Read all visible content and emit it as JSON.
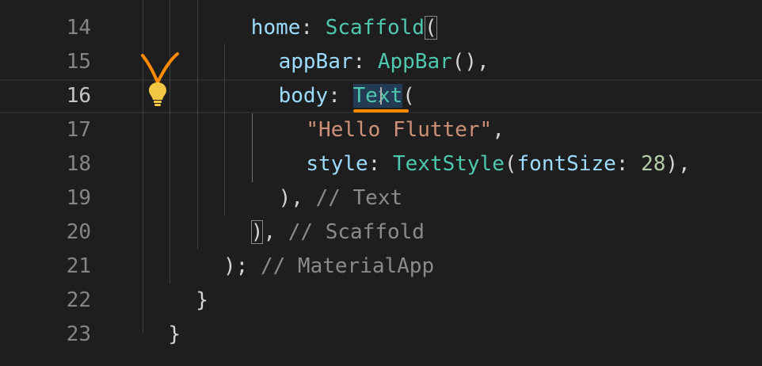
{
  "editor": {
    "lines": [
      {
        "number": "14",
        "tokens": [
          {
            "text": "home",
            "kind": "prop"
          },
          {
            "text": ": ",
            "kind": "punc"
          },
          {
            "text": "Scaffold",
            "kind": "cls"
          },
          {
            "text": "(",
            "kind": "punc",
            "bracket_match": true
          }
        ]
      },
      {
        "number": "15",
        "tokens": [
          {
            "text": "appBar",
            "kind": "prop"
          },
          {
            "text": ": ",
            "kind": "punc"
          },
          {
            "text": "AppBar",
            "kind": "cls"
          },
          {
            "text": "(),",
            "kind": "punc"
          }
        ]
      },
      {
        "number": "16",
        "tokens": [
          {
            "text": "body",
            "kind": "prop"
          },
          {
            "text": ": ",
            "kind": "punc"
          },
          {
            "text": "Text",
            "kind": "cls",
            "highlighted": true
          },
          {
            "text": "(",
            "kind": "punc"
          }
        ]
      },
      {
        "number": "17",
        "tokens": [
          {
            "text": "\"Hello Flutter\"",
            "kind": "str"
          },
          {
            "text": ",",
            "kind": "punc"
          }
        ]
      },
      {
        "number": "18",
        "tokens": [
          {
            "text": "style",
            "kind": "prop"
          },
          {
            "text": ": ",
            "kind": "punc"
          },
          {
            "text": "TextStyle",
            "kind": "cls"
          },
          {
            "text": "(",
            "kind": "punc"
          },
          {
            "text": "fontSize",
            "kind": "prop"
          },
          {
            "text": ": ",
            "kind": "punc"
          },
          {
            "text": "28",
            "kind": "num"
          },
          {
            "text": "),",
            "kind": "punc"
          }
        ]
      },
      {
        "number": "19",
        "tokens": [
          {
            "text": "), ",
            "kind": "punc"
          },
          {
            "text": "// Text",
            "kind": "cmt"
          }
        ]
      },
      {
        "number": "20",
        "tokens": [
          {
            "text": ")",
            "kind": "punc",
            "bracket_match": true
          },
          {
            "text": ", ",
            "kind": "punc"
          },
          {
            "text": "// Scaffold",
            "kind": "cmt"
          }
        ]
      },
      {
        "number": "21",
        "tokens": [
          {
            "text": "); ",
            "kind": "punc"
          },
          {
            "text": "// MaterialApp",
            "kind": "cmt"
          }
        ]
      },
      {
        "number": "22",
        "tokens": [
          {
            "text": "}",
            "kind": "punc"
          }
        ]
      },
      {
        "number": "23",
        "tokens": [
          {
            "text": "}",
            "kind": "punc"
          }
        ]
      }
    ],
    "current_line": "16"
  },
  "icons": {
    "lightbulb": "lightbulb-icon",
    "annotation": "orange-check-annotation"
  },
  "colors": {
    "background": "#1e1e1e",
    "property": "#9cdcfe",
    "class": "#4ec9b0",
    "string": "#ce9178",
    "number": "#b5cea8",
    "comment": "#8b8b8b",
    "lightbulb": "#f2c744",
    "annotation": "#ff8c00"
  }
}
